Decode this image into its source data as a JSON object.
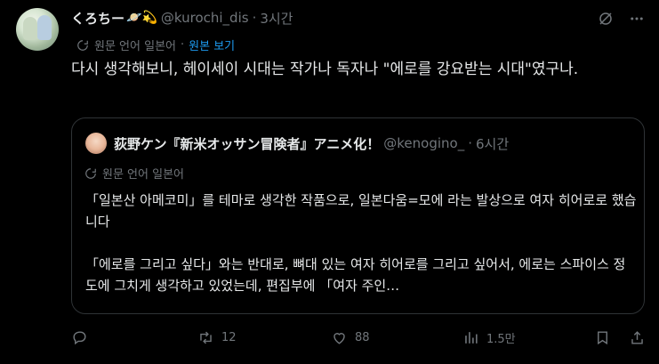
{
  "author": {
    "name": "くろちー",
    "emoji": "🪐💫",
    "handle": "@kurochi_dis",
    "separator": "·",
    "time": "3시간"
  },
  "translation": {
    "original_label": "원문 언어 일본어",
    "show_original": "원본 보기"
  },
  "tweet_text": "다시 생각해보니, 헤이세이 시대는 작가나 독자나 \"에로를 강요받는 시대\"였구나.",
  "quote": {
    "name": "荻野ケン『新米オッサン冒険者』アニメ化！",
    "handle": "@kenogino_",
    "separator": "·",
    "time": "6시간",
    "translation_label": "원문 언어 일본어",
    "text": "「일본산 아메코미」를 테마로 생각한 작품으로, 일본다움=모에 라는 발상으로 여자 히어로로 했습니다\n\n「에로를 그리고 싶다」와는 반대로, 뼈대 있는 여자 히어로를 그리고 싶어서, 에로는 스파이스 정도에 그치게 생각하고 있었는데, 편집부에 「여자 주인…"
  },
  "actions": {
    "reply_count": "",
    "retweet_count": "12",
    "like_count": "88",
    "views_count": "1.5만"
  },
  "colors": {
    "background": "#000000",
    "text": "#e7e9ea",
    "muted": "#71767b",
    "link": "#1d9bf0",
    "border": "#2f3336"
  }
}
